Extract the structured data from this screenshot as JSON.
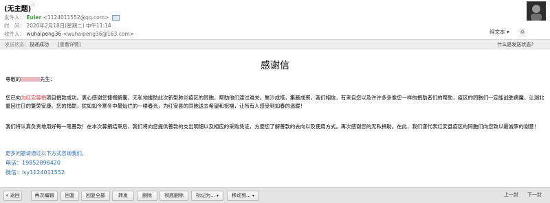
{
  "header": {
    "subject": "(无主题)",
    "star_glyph": "☆",
    "from_label": "发件人：",
    "from_name": "Euler",
    "from_addr": "<1124011552@qq.com>",
    "time_label": "时　间：",
    "time_value": "2020年2月18日(星期二) 中午11:14",
    "to_label": "收件人：",
    "to_name": "wuhaipeng36",
    "to_addr": "<wuhaipeng36@163.com>",
    "plain_text": "纯文本",
    "plain_caret": "▾",
    "print_glyph": "⎙"
  },
  "status": {
    "label": "发送状态:",
    "value": "投递成功",
    "details": "[查看详情]",
    "help": "什么是发送状态?"
  },
  "email": {
    "title": "感谢信",
    "greeting_prefix": "尊敬的",
    "greeting_suffix": "先生：",
    "p1_a": "您已向",
    "p1_org": "为红安募捐",
    "p1_b": "项目捐款成功。衷心感谢您慷慨解囊，无私地援助此次新型肺炎疫区的同胞，帮助他们渡过难关。聚沙成塔，集腋成裘，我们相信，有来自您以及许许多多像您一样的捐助者们的帮助，疫区的同胞们一定能战胜病魔，让湖北重回往日的繁荣安康。您的捐助，犹如如今寒冬中最灿烂的一缕春光，为红安县的同胞送去希望和祝福，让所有人感受到如春的温暖！",
    "p2": "我们将认真负责地用好每一笔善款！在本次募捐结束后，我们将向您提供善款的支出明细以及相应的采购凭证，方便您了解善款的去向以及使用方式。再次感谢您的无私捐助。在此，我们谨代表红安县疫区的同胞们向您致以最诚挚的谢意！",
    "contact_intro": "更多问题请通过以下方式咨询我们。",
    "phone": "电话：19852896420",
    "wechat": "微信：lsy1124011552"
  },
  "toolbar": {
    "back": "« 返回",
    "reedit": "再次编辑",
    "reply": "回复",
    "reply_all": "回复全部",
    "forward": "转发",
    "delete": "删除",
    "delete_permanent": "彻底删除",
    "mark_as": "标记为...",
    "move_to": "移动到...",
    "caret": "▾",
    "prev": "上一封",
    "next": "下一封"
  }
}
